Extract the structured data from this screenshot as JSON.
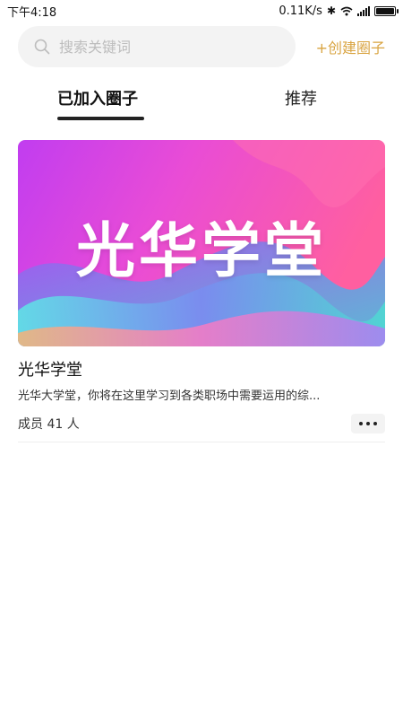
{
  "status_bar": {
    "time": "下午4:18",
    "network_speed": "0.11K/s"
  },
  "search": {
    "placeholder": "搜索关键词",
    "value": ""
  },
  "header": {
    "create_label": "+创建圈子"
  },
  "tabs": [
    {
      "label": "已加入圈子",
      "active": true
    },
    {
      "label": "推荐",
      "active": false
    }
  ],
  "circles": [
    {
      "banner_text": "光华学堂",
      "title": "光华学堂",
      "description": "光华大学堂，你将在这里学习到各类职场中需要运用的综...",
      "members": "成员 41 人"
    }
  ],
  "colors": {
    "accent": "#d9a441",
    "tab_underline": "#222222"
  },
  "icons": {
    "search": "search-icon",
    "more": "more-icon"
  }
}
